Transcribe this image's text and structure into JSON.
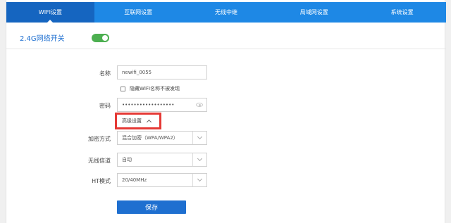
{
  "tabs": [
    {
      "label": "WIFI设置",
      "active": true
    },
    {
      "label": "互联网设置",
      "active": false
    },
    {
      "label": "无线中继",
      "active": false
    },
    {
      "label": "局域网设置",
      "active": false
    },
    {
      "label": "系统设置",
      "active": false
    }
  ],
  "wifi_switch": {
    "label": "2.4G网络开关",
    "enabled": true
  },
  "form": {
    "name_label": "名称",
    "name_value": "newifi_0055",
    "hide_ssid_label": "隐藏WIFI名称不被发现",
    "hide_ssid_checked": false,
    "password_label": "密码",
    "password_value": "••••••••••••••••••",
    "advanced_label": "高级设置",
    "encryption_label": "加密方式",
    "encryption_value": "混合加密（WPA/WPA2）",
    "channel_label": "无线信道",
    "channel_value": "自动",
    "ht_label": "HT模式",
    "ht_value": "20/40MHz",
    "save_label": "保存"
  },
  "colors": {
    "tabbar": "#1e88e5",
    "tab_active": "#1565c0",
    "toggle_on": "#4caf50",
    "save_button": "#1e6fd0",
    "highlight_box": "#e53935"
  }
}
